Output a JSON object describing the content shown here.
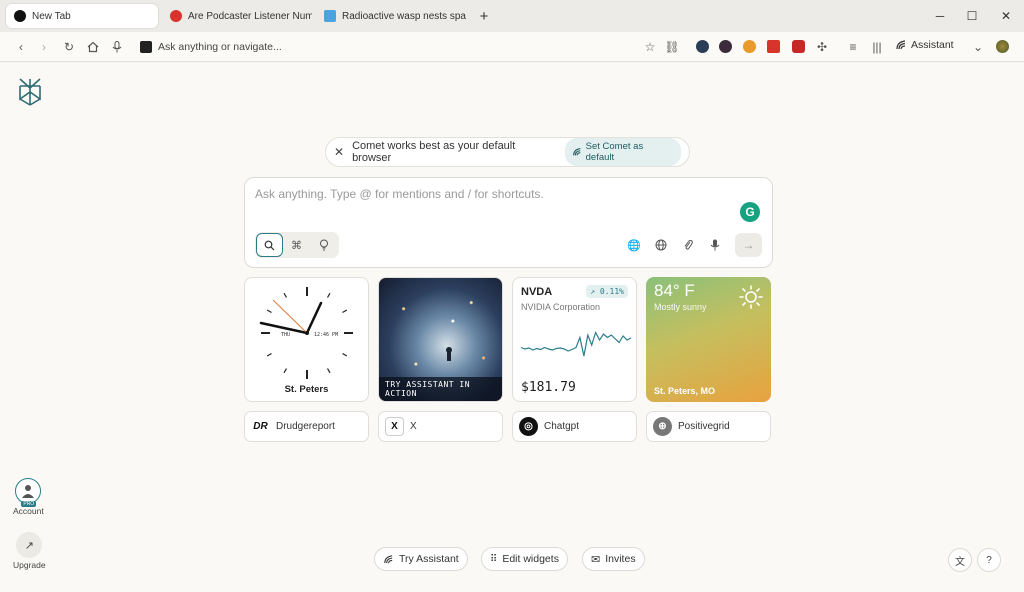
{
  "tabs": [
    {
      "title": "New Tab",
      "active": true,
      "favicon_color": "#111111"
    },
    {
      "title": "Are Podcaster Listener Numbe",
      "active": false,
      "favicon_color": "#d9342b"
    },
    {
      "title": "Radioactive wasp nests spark",
      "active": false,
      "favicon_color": "#4aa3df"
    }
  ],
  "window": {
    "minimize": "─",
    "maximize": "☐",
    "close": "✕",
    "new_tab": "+"
  },
  "toolbar": {
    "omnibox_placeholder": "Ask anything or navigate...",
    "assistant_label": "Assistant"
  },
  "banner": {
    "text": "Comet works best as your default browser",
    "action": "Set Comet as default"
  },
  "search": {
    "placeholder": "Ask anything. Type @ for mentions and / for shortcuts.",
    "grammarly": "G"
  },
  "widgets": {
    "clock": {
      "city": "St. Peters",
      "day": "THU",
      "time": "12:46 PM"
    },
    "image": {
      "caption": "TRY ASSISTANT IN ACTION"
    },
    "stock": {
      "symbol": "NVDA",
      "name": "NVIDIA Corporation",
      "change": "↗ 0.11%",
      "price": "$181.79",
      "trend": [
        0.55,
        0.58,
        0.56,
        0.6,
        0.57,
        0.59,
        0.55,
        0.58,
        0.6,
        0.57,
        0.56,
        0.58,
        0.62,
        0.59,
        0.55,
        0.35,
        0.72,
        0.3,
        0.5,
        0.25,
        0.4,
        0.28,
        0.35,
        0.3,
        0.38,
        0.45,
        0.32,
        0.4,
        0.36
      ]
    },
    "weather": {
      "temp": "84° F",
      "condition": "Mostly sunny",
      "location": "St. Peters, MO"
    }
  },
  "shortcuts": [
    {
      "label": "Drudgereport",
      "logo": "DR"
    },
    {
      "label": "X",
      "logo": "X"
    },
    {
      "label": "Chatgpt",
      "logo": "◎"
    },
    {
      "label": "Positivegrid",
      "logo": "⊕"
    }
  ],
  "sidebar": {
    "account_label": "Account",
    "pro_badge": "PRO",
    "upgrade_label": "Upgrade"
  },
  "bottom": {
    "try_assistant": "Try Assistant",
    "edit_widgets": "Edit widgets",
    "invites": "Invites"
  },
  "colors": {
    "accent": "#2a7d88",
    "background": "#faf9f6"
  }
}
